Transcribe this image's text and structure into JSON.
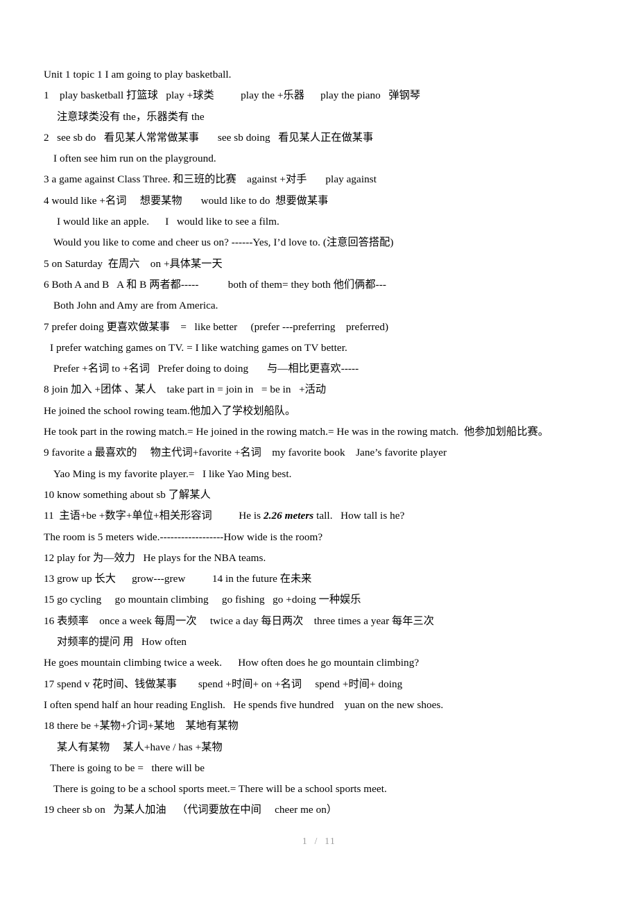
{
  "document": {
    "title_line": "Unit 1 topic 1 I am going to play basketball.",
    "lines": [
      {
        "text": "Unit 1 topic 1 I am going to play basketball.",
        "indent": 0
      },
      {
        "text": "1    play basketball 打篮球   play +球类          play the +乐器      play the piano   弹钢琴",
        "indent": 0
      },
      {
        "text": "注意球类没有 the，乐器类有 the",
        "indent": 3
      },
      {
        "text": "2   see sb do   看见某人常常做某事       see sb doing   看见某人正在做某事",
        "indent": 0
      },
      {
        "text": "I often see him run on the playground.",
        "indent": 2
      },
      {
        "text": "3 a game against Class Three. 和三班的比赛    against +对手       play against",
        "indent": 0
      },
      {
        "text": "4 would like +名词     想要某物       would like to do  想要做某事",
        "indent": 0
      },
      {
        "text": "I would like an apple.      I   would like to see a film.",
        "indent": 3
      },
      {
        "text": "Would you like to come and cheer us on? ------Yes, I’d love to. (注意回答搭配)",
        "indent": 2
      },
      {
        "text": "5 on Saturday  在周六    on +具体某一天",
        "indent": 0
      },
      {
        "text": "6 Both A and B   A 和 B 两者都-----           both of them= they both 他们俩都---",
        "indent": 0
      },
      {
        "text": "Both John and Amy are from America.",
        "indent": 2
      },
      {
        "text": "7 prefer doing 更喜欢做某事    =   like better     (prefer ---preferring    preferred)",
        "indent": 0
      },
      {
        "text": "I prefer watching games on TV. = I like watching games on TV better.",
        "indent": 1
      },
      {
        "text": "Prefer +名词 to +名词   Prefer doing to doing       与—相比更喜欢-----",
        "indent": 2
      },
      {
        "text": "8 join 加入 +团体 、某人    take part in = join in   = be in   +活动",
        "indent": 0
      },
      {
        "text": "He joined the school rowing team.他加入了学校划船队。",
        "indent": 0
      },
      {
        "text": "He took part in the rowing match.= He joined in the rowing match.= He was in the rowing match.  他参加划船比赛。",
        "indent": 0
      },
      {
        "text": "9 favorite a 最喜欢的     物主代词+favorite +名词    my favorite book    Jane’s favorite player",
        "indent": 0
      },
      {
        "text": "Yao Ming is my favorite player.=   I like Yao Ming best.",
        "indent": 2
      },
      {
        "text": "10 know something about sb 了解某人",
        "indent": 0
      },
      {
        "text": "11  主语+be +数字+单位+相关形容词          He is ",
        "indent": 0,
        "bold_italic": "2.26 meters",
        "text_after": " tall.   How tall is he?"
      },
      {
        "text": "The room is 5 meters wide.------------------How wide is the room?",
        "indent": 0
      },
      {
        "text": "12 play for 为—效力   He plays for the NBA teams.",
        "indent": 0
      },
      {
        "text": "13 grow up 长大      grow---grew          14 in the future 在未来",
        "indent": 0
      },
      {
        "text": "15 go cycling     go mountain climbing     go fishing   go +doing 一种娱乐",
        "indent": 0
      },
      {
        "text": "16 表频率    once a week 每周一次     twice a day 每日两次    three times a year 每年三次",
        "indent": 0
      },
      {
        "text": "对频率的提问 用   How often",
        "indent": 3
      },
      {
        "text": "He goes mountain climbing twice a week.      How often does he go mountain climbing?",
        "indent": 0
      },
      {
        "text": "17 spend v 花时间、钱做某事        spend +时间+ on +名词     spend +时间+ doing",
        "indent": 0
      },
      {
        "text": "I often spend half an hour reading English.   He spends five hundred    yuan on the new shoes.",
        "indent": 0
      },
      {
        "text": "18 there be +某物+介词+某地    某地有某物",
        "indent": 0
      },
      {
        "text": "某人有某物     某人+have / has +某物",
        "indent": 3
      },
      {
        "text": "There is going to be =   there will be",
        "indent": 1
      },
      {
        "text": "There is going to be a school sports meet.= There will be a school sports meet.",
        "indent": 2
      },
      {
        "text": "19 cheer sb on   为某人加油    （代词要放在中间     cheer me on）",
        "indent": 0
      }
    ]
  },
  "footer": {
    "page_indicator": "1  /  11"
  }
}
